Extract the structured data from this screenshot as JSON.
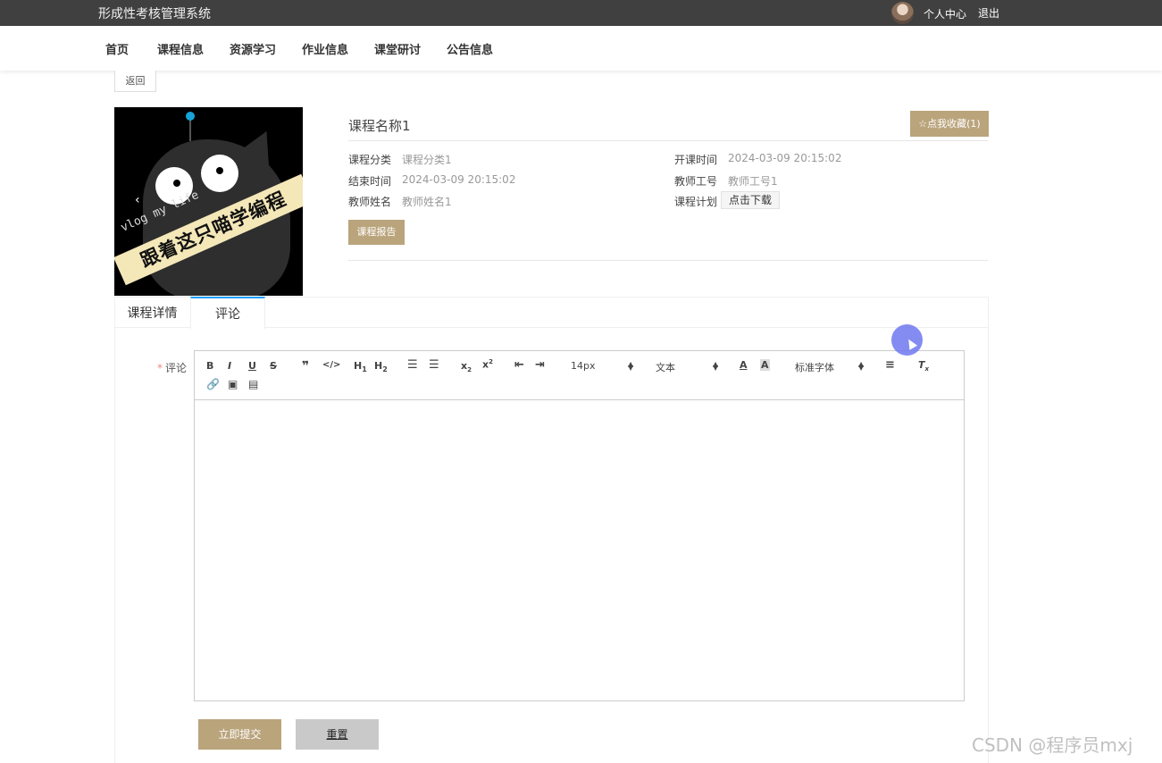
{
  "topbar": {
    "title": "形成性考核管理系统",
    "user_center": "个人中心",
    "logout": "退出"
  },
  "nav": {
    "items": [
      "首页",
      "课程信息",
      "资源学习",
      "作业信息",
      "课堂研讨",
      "公告信息"
    ]
  },
  "back_label": "返回",
  "course": {
    "name": "课程名称1",
    "favorite_label": "☆点我收藏(1)",
    "category_label": "课程分类",
    "category_value": "课程分类1",
    "start_label": "开课时间",
    "start_value": "2024-03-09 20:15:02",
    "end_label": "结束时间",
    "end_value": "2024-03-09 20:15:02",
    "teacher_no_label": "教师工号",
    "teacher_no_value": "教师工号1",
    "teacher_name_label": "教师姓名",
    "teacher_name_value": "教师姓名1",
    "plan_label": "课程计划",
    "download_label": "点击下载",
    "report_label": "课程报告"
  },
  "cover": {
    "banner_text": "跟着这只喵学编程",
    "vlog_text": "vlog my life",
    "arrow": "‹"
  },
  "tabs": {
    "details": "课程详情",
    "comments": "评论"
  },
  "comment_form": {
    "label": "评论",
    "required_mark": "*",
    "font_size": "14px",
    "block_format": "文本",
    "font_family": "标准字体",
    "submit_label": "立即提交",
    "reset_label": "重置"
  },
  "watermark": "CSDN @程序员mxj",
  "colors": {
    "accent": "#baa47c",
    "topbar": "#404040",
    "tab_active": "#1e9fff"
  }
}
